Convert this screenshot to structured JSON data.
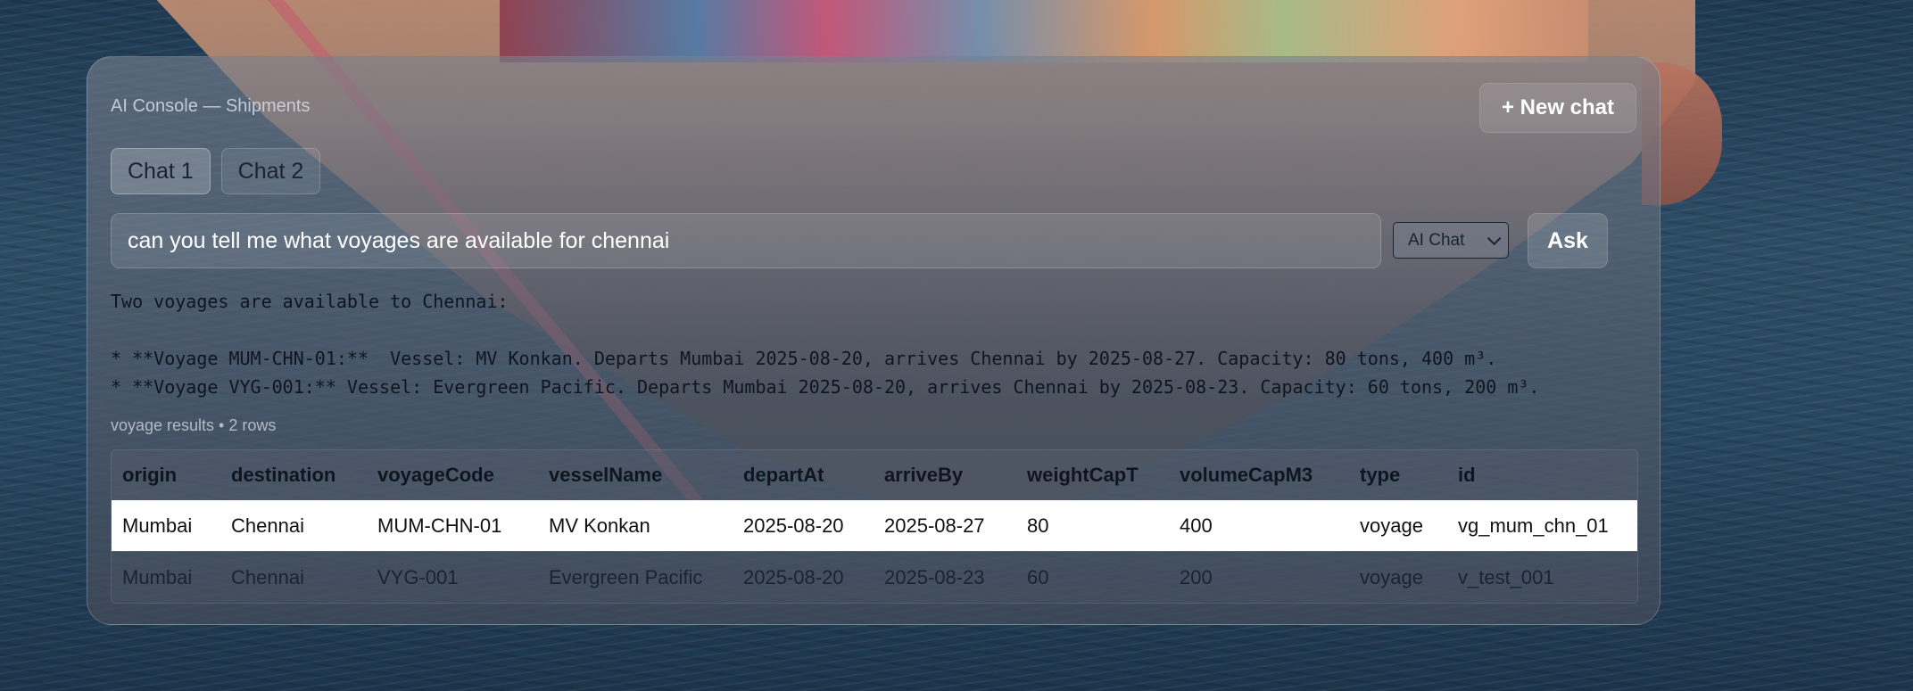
{
  "panel": {
    "title": "AI Console — Shipments",
    "new_chat_label": "+ New chat"
  },
  "tabs": [
    {
      "label": "Chat 1",
      "active": true
    },
    {
      "label": "Chat 2",
      "active": false
    }
  ],
  "query": {
    "value": "can you tell me what voyages are available for chennai"
  },
  "mode_select": {
    "selected": "AI Chat"
  },
  "ask_label": "Ask",
  "answer": {
    "lines": [
      "Two voyages are available to Chennai:",
      "",
      "* **Voyage MUM-CHN-01:**  Vessel: MV Konkan. Departs Mumbai 2025-08-20, arrives Chennai by 2025-08-27. Capacity: 80 tons, 400 m³.",
      "* **Voyage VYG-001:** Vessel: Evergreen Pacific. Departs Mumbai 2025-08-20, arrives Chennai by 2025-08-23. Capacity: 60 tons, 200 m³."
    ]
  },
  "results": {
    "caption": "voyage results • 2 rows",
    "columns": [
      "origin",
      "destination",
      "voyageCode",
      "vesselName",
      "departAt",
      "arriveBy",
      "weightCapT",
      "volumeCapM3",
      "type",
      "id"
    ],
    "rows": [
      [
        "Mumbai",
        "Chennai",
        "MUM-CHN-01",
        "MV Konkan",
        "2025-08-20",
        "2025-08-27",
        "80",
        "400",
        "voyage",
        "vg_mum_chn_01"
      ],
      [
        "Mumbai",
        "Chennai",
        "VYG-001",
        "Evergreen Pacific",
        "2025-08-20",
        "2025-08-23",
        "60",
        "200",
        "voyage",
        "v_test_001"
      ]
    ]
  },
  "colors": {
    "highlight_row": "#ffffff",
    "text_dark": "#0f1520",
    "text_light": "#ffffff"
  }
}
